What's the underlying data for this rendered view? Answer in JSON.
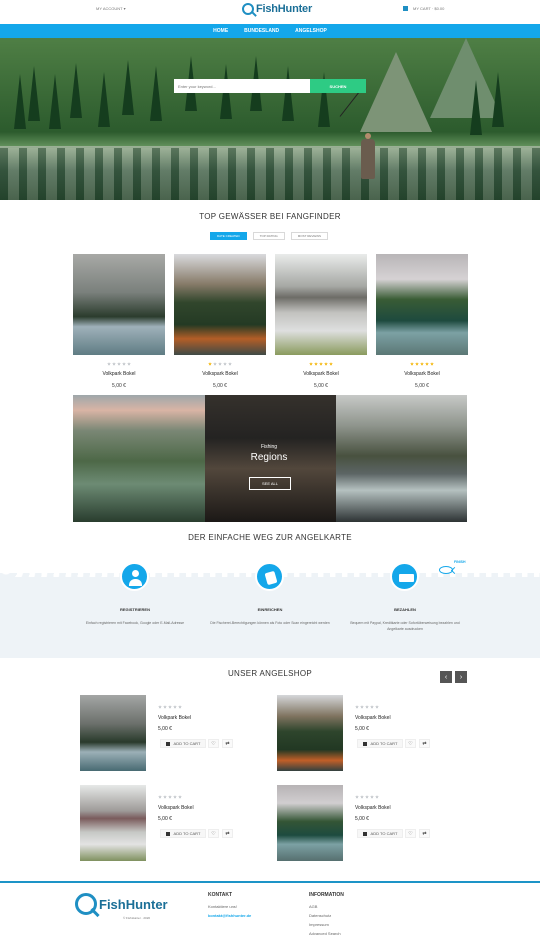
{
  "header": {
    "account": "MY ACCOUNT ▾",
    "logo": "FishHunter",
    "cart_text": "MY CART · $0.00"
  },
  "nav": [
    "HOME",
    "BUNDESLAND",
    "ANGELSHOP"
  ],
  "search": {
    "placeholder": "Enter your keyword...",
    "button": "SUCHEN"
  },
  "top_waters": {
    "title": "TOP GEWÄSSER BEI FANGFINDER",
    "tabs": [
      "DATE CREATED",
      "TOP RATING",
      "MOST REVIEWS"
    ],
    "products": [
      {
        "name": "Volkpark Bokel",
        "price": "5,00 €",
        "rating": 0
      },
      {
        "name": "Volkspark Bokel",
        "price": "5,00 €",
        "rating": 1
      },
      {
        "name": "Volkspark Bokel",
        "price": "5,00 €",
        "rating": 5
      },
      {
        "name": "Volkspark Bokel",
        "price": "5,00 €",
        "rating": 5
      }
    ]
  },
  "regions": {
    "fishing": "Fishing",
    "title": "Regions",
    "button": "SEE ALL"
  },
  "steps": {
    "title": "DER EINFACHE WEG ZUR ANGELKARTE",
    "finish": "FINISH",
    "items": [
      {
        "title": "REGISTRIEREN",
        "text": "Einfach registrieren mit Facebook, Google oder E-Mail-Adresse"
      },
      {
        "title": "EINREICHEN",
        "text": "Die Fischerei-Berechtigungen können als Foto oder Scan eingereicht werden"
      },
      {
        "title": "BEZAHLEN",
        "text": "Bequem mit Paypal, Kreditkarte oder Sofortüberweisung bezahlen und Angelkarte ausdrucken"
      }
    ]
  },
  "shop": {
    "title": "UNSER ANGELSHOP",
    "prev": "‹",
    "next": "›",
    "add_to_cart": "ADD TO CART",
    "items": [
      {
        "name": "Volkpark Bokel",
        "price": "5,00 €"
      },
      {
        "name": "Volkspark Bokel",
        "price": "5,00 €"
      },
      {
        "name": "Volkspark Bokel",
        "price": "5,00 €"
      },
      {
        "name": "Volkspark Bokel",
        "price": "5,00 €"
      }
    ]
  },
  "footer": {
    "logo": "FishHunter",
    "copyright": "© FishHunter · 2020",
    "contact": {
      "heading": "KONTAKT",
      "text": "Kontaktiere uns!",
      "email": "kontakt@fishhunter.de"
    },
    "information": {
      "heading": "INFORMATION",
      "links": [
        "AGB",
        "Datenschutz",
        "Impressum",
        "Advanced Search"
      ]
    }
  }
}
